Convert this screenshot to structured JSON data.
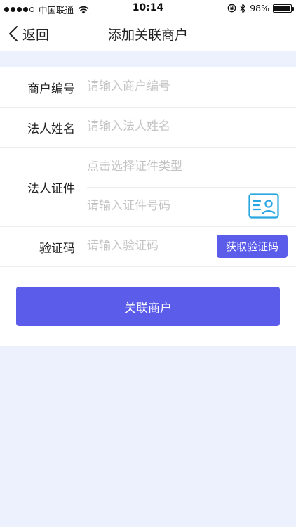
{
  "status_bar": {
    "carrier": "中国联通",
    "time": "10:14",
    "battery": "98%",
    "battery_level": 0.98,
    "icons": [
      "signal-dots-icon",
      "wifi-icon",
      "rotation-lock-icon",
      "bluetooth-icon",
      "battery-icon"
    ]
  },
  "nav": {
    "back_label": "返回",
    "title": "添加关联商户",
    "back_icon": "chevron-left-icon"
  },
  "form": {
    "merchant_no": {
      "label": "商户编号",
      "value": "",
      "placeholder": "请输入商户编号"
    },
    "legal_name": {
      "label": "法人姓名",
      "value": "",
      "placeholder": "请输入法人姓名"
    },
    "legal_id": {
      "label": "法人证件",
      "type_placeholder": "点击选择证件类型",
      "number_value": "",
      "number_placeholder": "请输入证件号码",
      "scan_icon": "id-card-icon"
    },
    "verify_code": {
      "label": "验证码",
      "value": "",
      "placeholder": "请输入验证码",
      "button_label": "获取验证码"
    }
  },
  "submit_label": "关联商户",
  "colors": {
    "accent": "#5b5cea",
    "page_bg": "#ecf1fd",
    "placeholder": "#c4c4c4",
    "icon": "#2aa7e0"
  }
}
